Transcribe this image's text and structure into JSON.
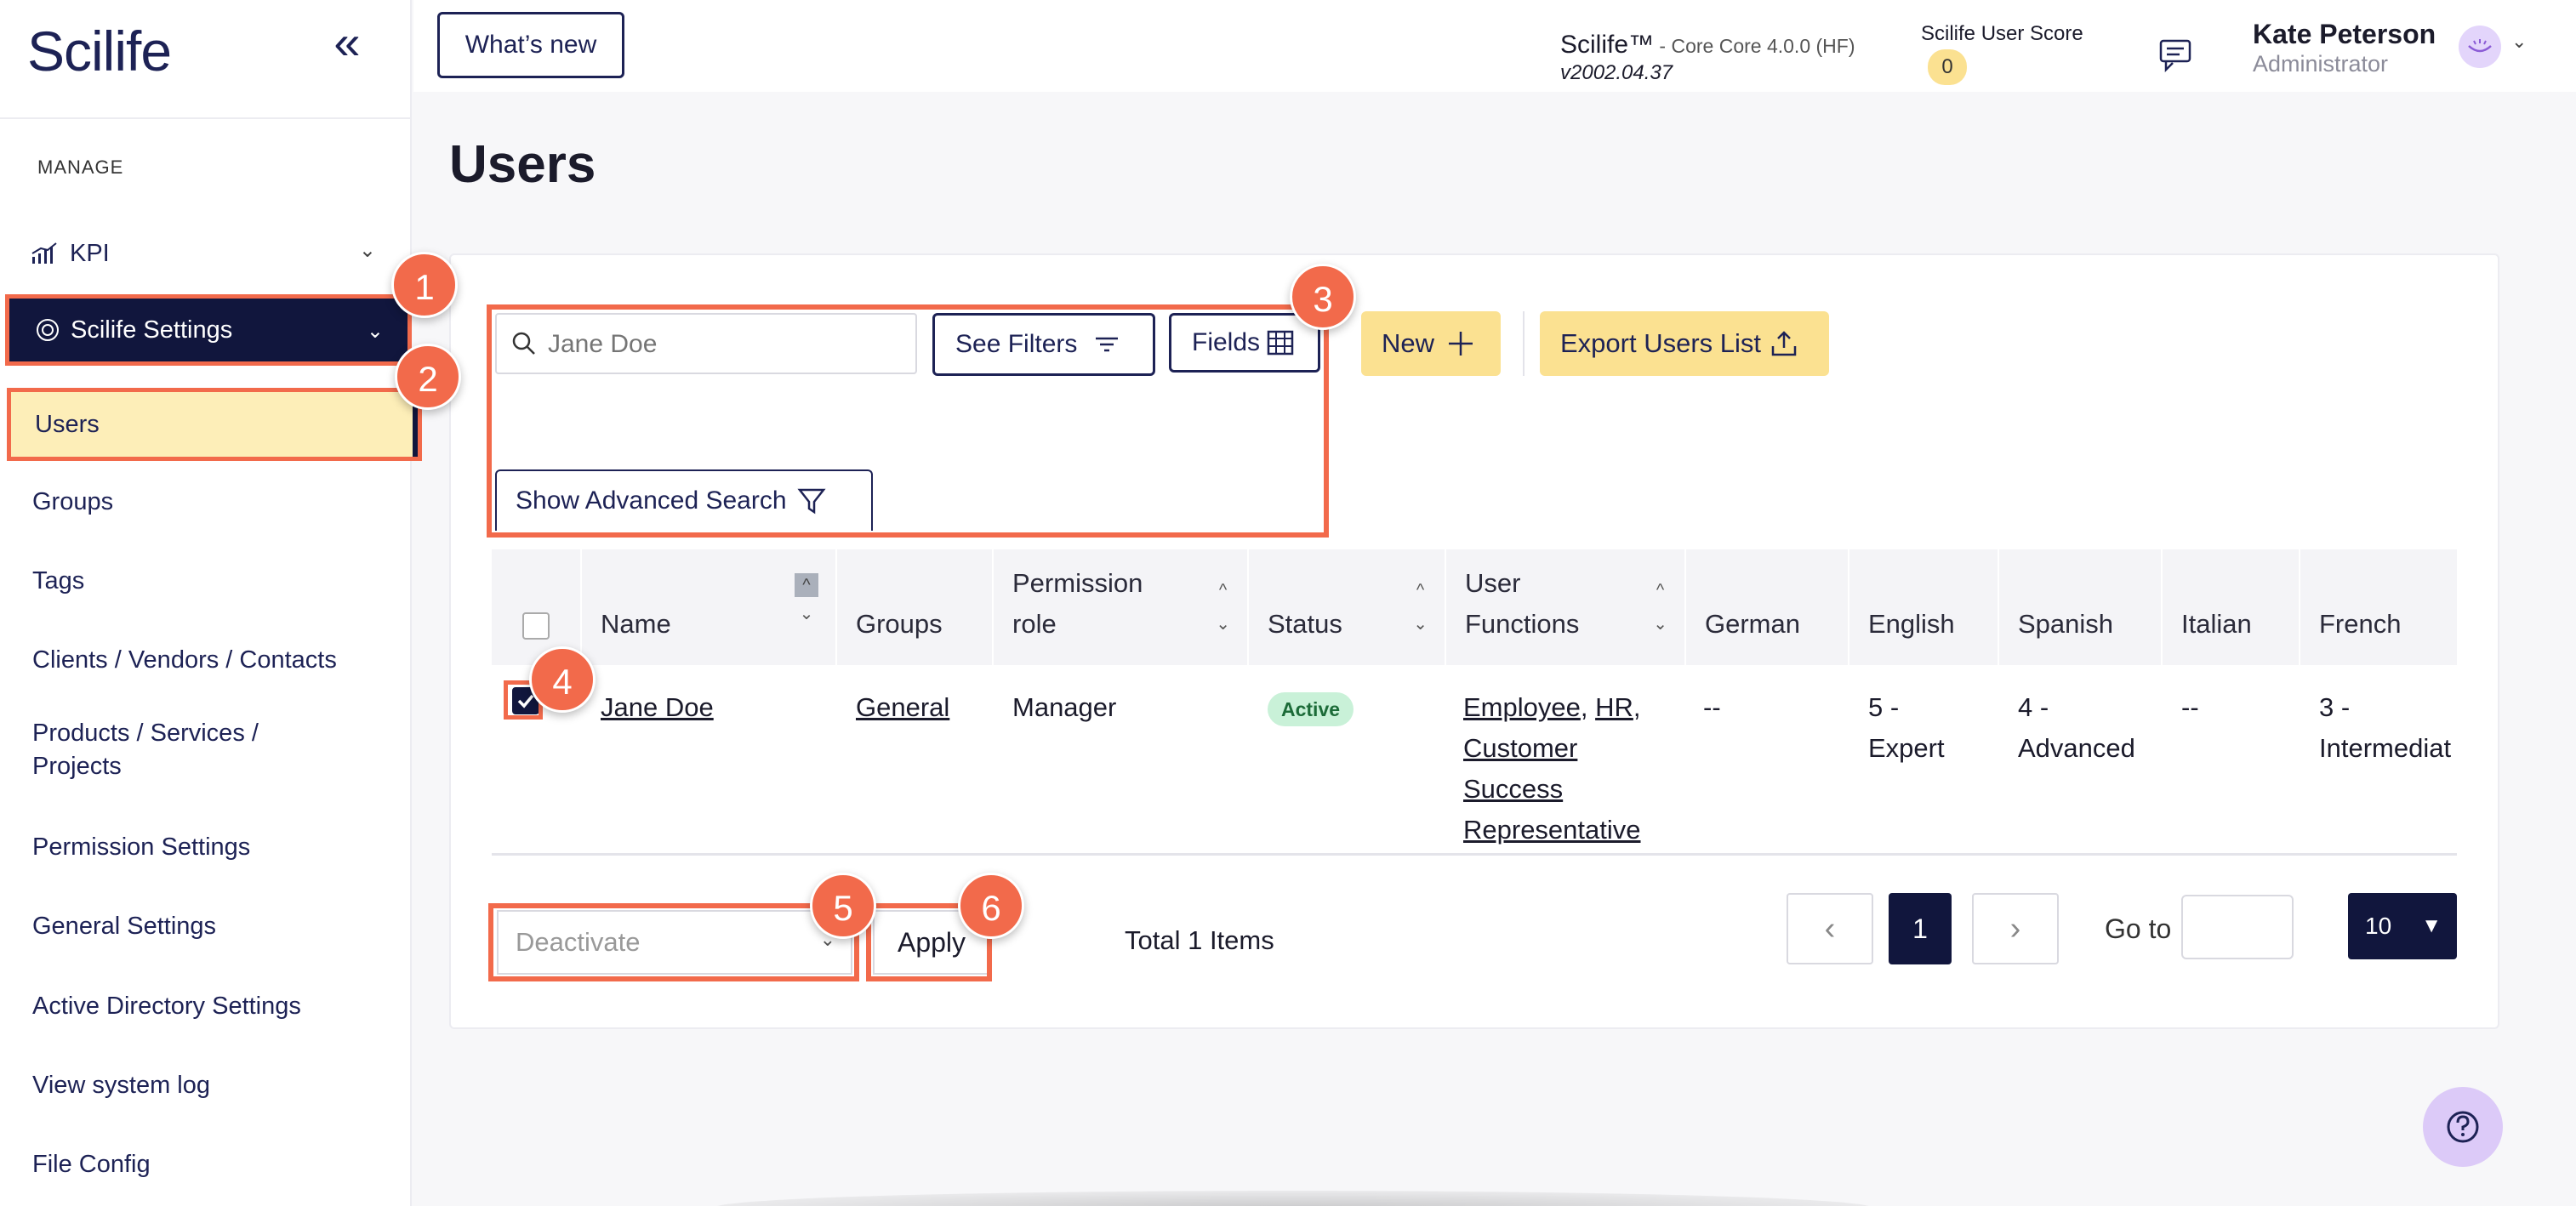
{
  "app": {
    "logo": "Scilife",
    "whats_new": "What’s new",
    "name": "Scilife™",
    "name_sub": " - Core Core 4.0.0 (HF)",
    "version": "v2002.04.37",
    "score_label": "Scilife User Score",
    "score_value": "0"
  },
  "user": {
    "name": "Kate Peterson",
    "role": "Administrator"
  },
  "sidebar": {
    "section_label": "MANAGE",
    "kpi": "KPI",
    "settings": "Scilife Settings",
    "items": [
      "Users",
      "Groups",
      "Tags",
      "Clients / Vendors / Contacts",
      "Products / Services /",
      "Projects",
      "Permission Settings",
      "General Settings",
      "Active Directory Settings",
      "View system log",
      "File Config"
    ]
  },
  "page": {
    "title": "Users"
  },
  "toolbar": {
    "search_placeholder": "Jane Doe",
    "see_filters": "See Filters",
    "fields": "Fields",
    "new": "New",
    "export": "Export Users List",
    "advanced_search": "Show Advanced Search"
  },
  "table": {
    "headers": {
      "name": "Name",
      "groups": "Groups",
      "permission_1": "Permission",
      "permission_2": "role",
      "status": "Status",
      "functions_1": "User",
      "functions_2": "Functions",
      "german": "German",
      "english": "English",
      "spanish": "Spanish",
      "italian": "Italian",
      "french": "French"
    },
    "row": {
      "name": "Jane Doe",
      "group": "General",
      "permission": "Manager",
      "status": "Active",
      "func_1": "Employee",
      "func_2": "HR",
      "func_3": "Customer",
      "func_4": "Success",
      "func_5": "Representative",
      "german": "--",
      "english_1": "5 -",
      "english_2": "Expert",
      "spanish_1": "4 -",
      "spanish_2": "Advanced",
      "italian": "--",
      "french_1": "3 -",
      "french_2": "Intermediat"
    }
  },
  "footer": {
    "bulk_action": "Deactivate",
    "apply": "Apply",
    "total": "Total 1 Items",
    "current_page": "1",
    "goto_label": "Go to",
    "page_size": "10"
  },
  "callouts": [
    "1",
    "2",
    "3",
    "4",
    "5",
    "6"
  ],
  "colors": {
    "accent": "#f26a4b",
    "navy": "#11163d",
    "yellow": "#fbe191"
  }
}
